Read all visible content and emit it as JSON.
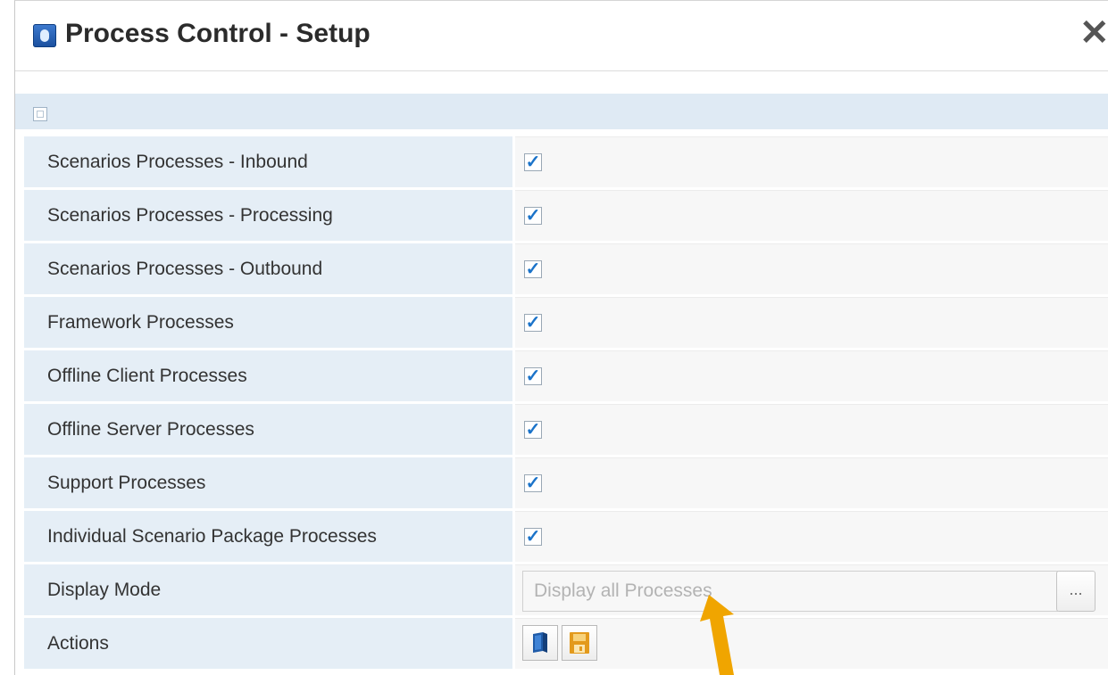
{
  "dialog": {
    "title": "Process Control - Setup",
    "close_glyph": "✕",
    "app_icon": "app-logo-icon"
  },
  "rows": [
    {
      "label": "Scenarios Processes - Inbound",
      "checked": true
    },
    {
      "label": "Scenarios Processes - Processing",
      "checked": true
    },
    {
      "label": "Scenarios Processes - Outbound",
      "checked": true
    },
    {
      "label": "Framework Processes",
      "checked": true
    },
    {
      "label": "Offline Client Processes",
      "checked": true
    },
    {
      "label": "Offline Server Processes",
      "checked": true
    },
    {
      "label": "Support Processes",
      "checked": true
    },
    {
      "label": "Individual Scenario Package Processes",
      "checked": true
    }
  ],
  "display_mode": {
    "label": "Display Mode",
    "placeholder": "Display all Processes",
    "lookup_label": "..."
  },
  "actions": {
    "label": "Actions",
    "buttons": [
      {
        "icon": "book-icon"
      },
      {
        "icon": "save-icon"
      }
    ]
  },
  "colors": {
    "checkmark": "#1b73c9",
    "label_bg": "#e5eef6",
    "section_bar": "#dfeaf4",
    "annotation_arrow": "#f0a500"
  }
}
